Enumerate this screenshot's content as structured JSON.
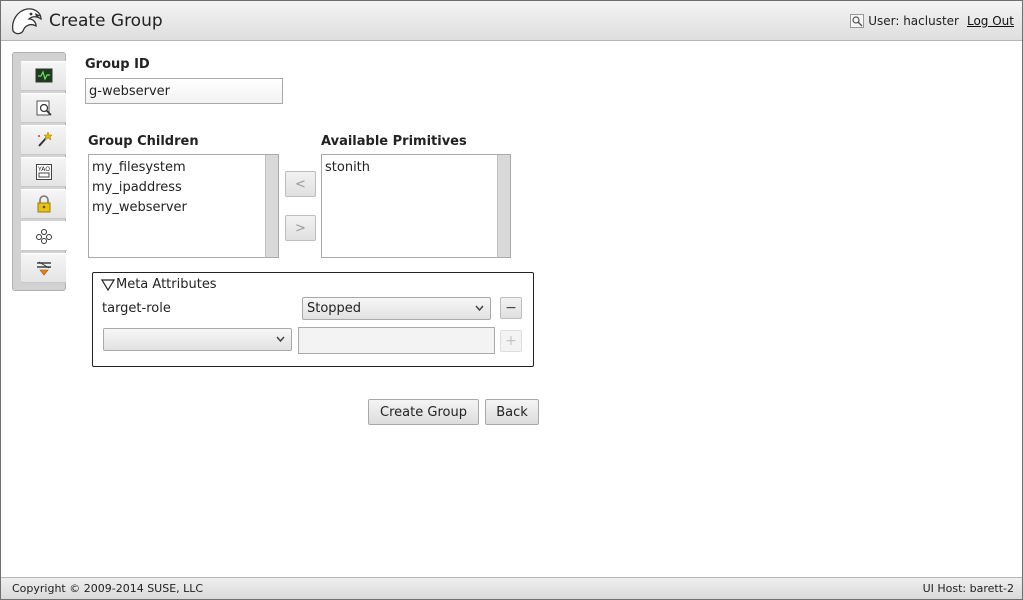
{
  "header": {
    "title": "Create Group",
    "user_label": "User: hacluster",
    "logout_label": "Log Out"
  },
  "sidenav": {
    "items": [
      {
        "name": "status",
        "icon": "monitor-icon"
      },
      {
        "name": "history",
        "icon": "history-icon"
      },
      {
        "name": "setup-wizard",
        "icon": "wand-icon"
      },
      {
        "name": "cluster-config",
        "icon": "config-icon"
      },
      {
        "name": "access-control",
        "icon": "lock-icon"
      },
      {
        "name": "resources",
        "icon": "resources-icon",
        "active": true
      },
      {
        "name": "constraints",
        "icon": "constraints-icon"
      }
    ]
  },
  "form": {
    "group_id_label": "Group ID",
    "group_id_value": "g-webserver",
    "children_label": "Group Children",
    "children": [
      "my_filesystem",
      "my_ipaddress",
      "my_webserver"
    ],
    "available_label": "Available Primitives",
    "available": [
      "stonith"
    ],
    "move_left_label": "<",
    "move_right_label": ">"
  },
  "meta": {
    "header": "Meta Attributes",
    "rows": [
      {
        "key": "target-role",
        "value": "Stopped"
      }
    ],
    "new_key": "",
    "new_value": "",
    "remove_label": "−",
    "add_label": "+"
  },
  "actions": {
    "create_label": "Create Group",
    "back_label": "Back"
  },
  "footer": {
    "copyright": "Copyright © 2009-2014 SUSE, LLC",
    "host": "UI Host: barett-2"
  }
}
